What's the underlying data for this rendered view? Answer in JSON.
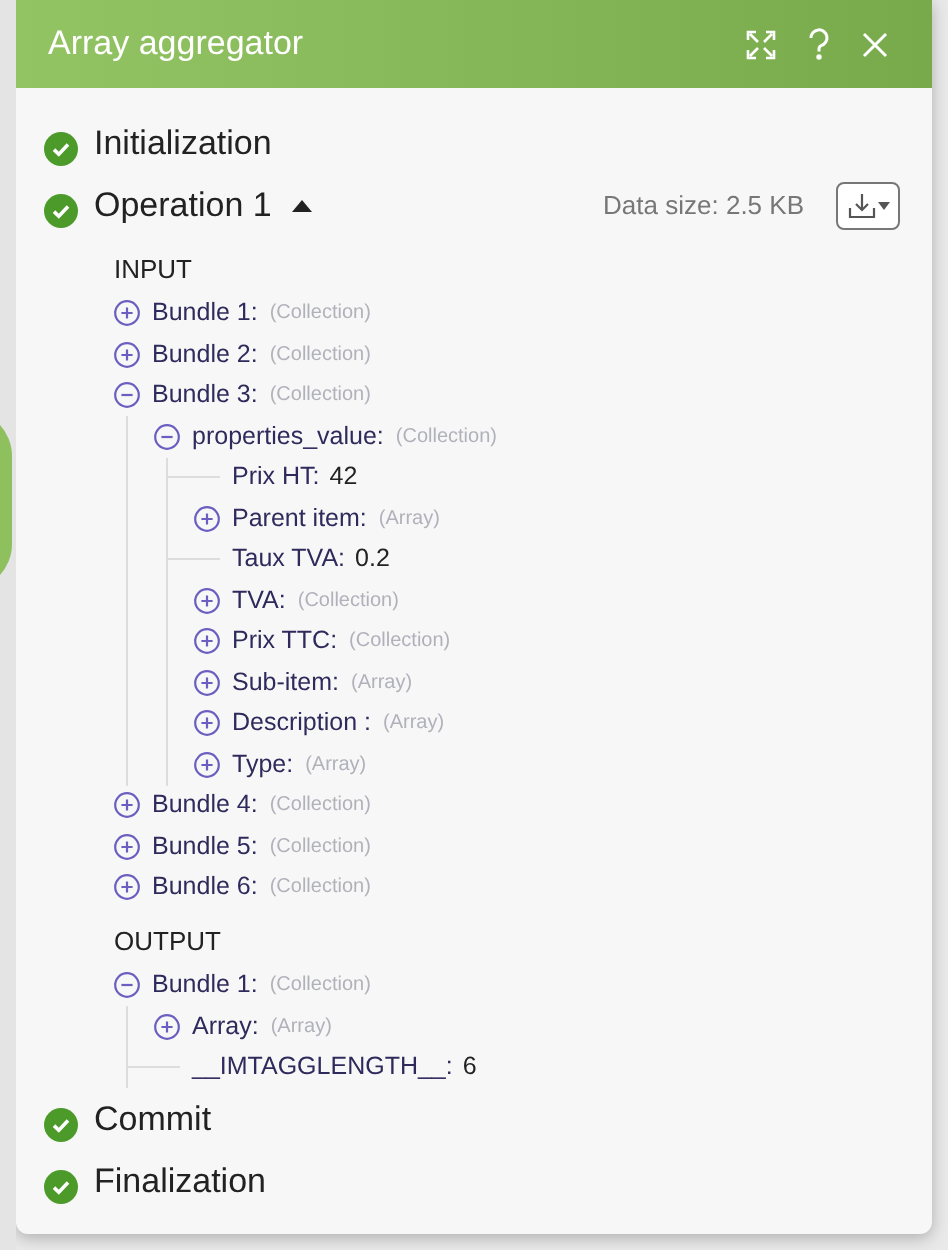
{
  "window": {
    "title": "Array aggregator"
  },
  "steps": [
    {
      "label": "Initialization",
      "done": true
    },
    {
      "label": "Operation 1",
      "done": true,
      "expanded": true,
      "data_size": "Data size: 2.5 KB",
      "sections": [
        {
          "heading": "INPUT",
          "items": [
            {
              "label": "Bundle 1:",
              "type": "(Collection)",
              "expanded": false
            },
            {
              "label": "Bundle 2:",
              "type": "(Collection)",
              "expanded": false
            },
            {
              "label": "Bundle 3:",
              "type": "(Collection)",
              "expanded": true,
              "children": [
                {
                  "label": "properties_value:",
                  "type": "(Collection)",
                  "expanded": true,
                  "children": [
                    {
                      "label": "Prix HT:",
                      "value": "42"
                    },
                    {
                      "label": "Parent item:",
                      "type": "(Array)",
                      "expanded": false
                    },
                    {
                      "label": "Taux TVA:",
                      "value": "0.2"
                    },
                    {
                      "label": "TVA:",
                      "type": "(Collection)",
                      "expanded": false
                    },
                    {
                      "label": "Prix TTC:",
                      "type": "(Collection)",
                      "expanded": false
                    },
                    {
                      "label": "Sub-item:",
                      "type": "(Array)",
                      "expanded": false
                    },
                    {
                      "label": "Description :",
                      "type": "(Array)",
                      "expanded": false
                    },
                    {
                      "label": "Type:",
                      "type": "(Array)",
                      "expanded": false
                    }
                  ]
                }
              ]
            },
            {
              "label": "Bundle 4:",
              "type": "(Collection)",
              "expanded": false
            },
            {
              "label": "Bundle 5:",
              "type": "(Collection)",
              "expanded": false
            },
            {
              "label": "Bundle 6:",
              "type": "(Collection)",
              "expanded": false
            }
          ]
        },
        {
          "heading": "OUTPUT",
          "items": [
            {
              "label": "Bundle 1:",
              "type": "(Collection)",
              "expanded": true,
              "children": [
                {
                  "label": "Array:",
                  "type": "(Array)",
                  "expanded": false
                },
                {
                  "label": "__IMTAGGLENGTH__:",
                  "value": "6"
                }
              ]
            }
          ]
        }
      ]
    },
    {
      "label": "Commit",
      "done": true
    },
    {
      "label": "Finalization",
      "done": true
    }
  ]
}
